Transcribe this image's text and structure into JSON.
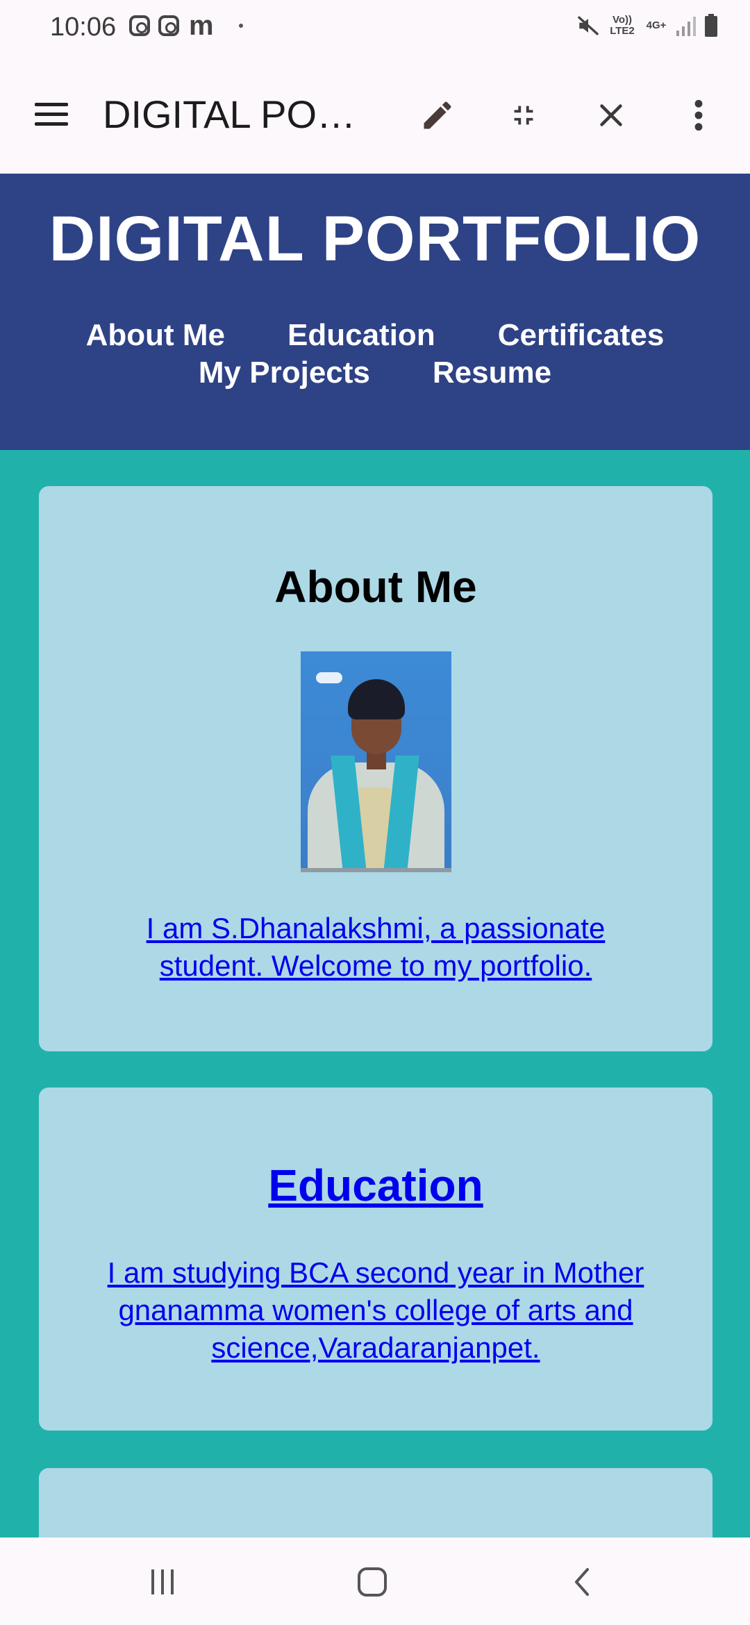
{
  "status_bar": {
    "time": "10:06",
    "network_label": "Vo)) LTE2",
    "data_label": "4G+",
    "icons": [
      "instagram-icon",
      "instagram-icon",
      "m-icon",
      "dot-icon",
      "mute-icon",
      "signal-icon",
      "battery-icon"
    ]
  },
  "app_bar": {
    "title": "DIGITAL PORTFOLIO",
    "icons": [
      "menu-icon",
      "edit-icon",
      "minimize-icon",
      "close-icon",
      "more-icon"
    ]
  },
  "header": {
    "site_title": "DIGITAL PORTFOLIO",
    "nav": [
      "About Me",
      "Education",
      "Certificates",
      "My Projects",
      "Resume"
    ],
    "background": "#2e4286"
  },
  "about": {
    "heading": "About Me",
    "text": "I am S.Dhanalakshmi, a passionate student. Welcome to my portfolio."
  },
  "education": {
    "heading": "Education",
    "text": "I am studying BCA second year in Mother gnanamma women's college of arts and science,Varadaranjanpet."
  },
  "colors": {
    "page_bg": "#20b2aa",
    "card_bg": "#add8e6",
    "link": "#0000ee"
  },
  "bottom_nav": {
    "icons": [
      "recent-apps-icon",
      "home-icon",
      "back-icon"
    ]
  }
}
